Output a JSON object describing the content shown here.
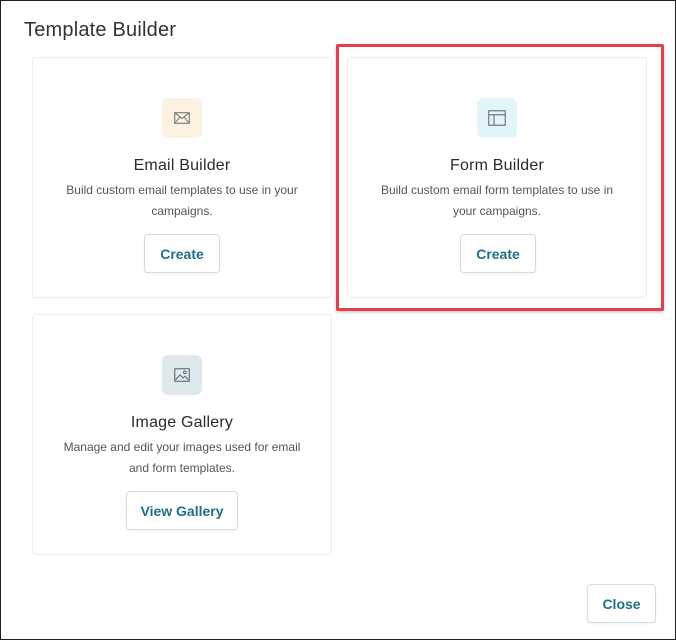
{
  "dialog": {
    "title": "Template Builder",
    "close_label": "Close"
  },
  "cards": {
    "email": {
      "icon": "envelope-icon",
      "icon_bg": "#fdf1e1",
      "title": "Email Builder",
      "description": "Build custom email templates to use in your campaigns.",
      "button_label": "Create"
    },
    "form": {
      "icon": "layout-icon",
      "icon_bg": "#e3f4fb",
      "title": "Form Builder",
      "description": "Build custom email form templates to use in your campaigns.",
      "button_label": "Create",
      "highlighted": true
    },
    "gallery": {
      "icon": "image-icon",
      "icon_bg": "#dfe9ec",
      "title": "Image Gallery",
      "description": "Manage and edit your images used for email and form templates.",
      "button_label": "View Gallery"
    }
  },
  "colors": {
    "accent": "#1f6f86",
    "highlight": "#e0424b"
  }
}
